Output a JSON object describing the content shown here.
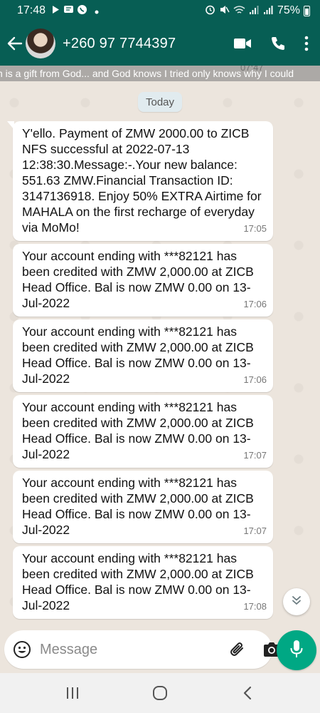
{
  "status_bar": {
    "time": "17:48",
    "battery": "75%",
    "left_icons": [
      "play-icon",
      "message-icon",
      "whatsapp-icon",
      "dot-icon"
    ],
    "right_icons": [
      "alarm-icon",
      "mute-icon",
      "wifi-icon",
      "signal-icon",
      "signal-icon",
      "battery-icon"
    ]
  },
  "header": {
    "contact": "+260 97 7744397",
    "icons": [
      "back-arrow-icon",
      "video-call-icon",
      "phone-icon",
      "more-vert-icon"
    ],
    "accent": "#075e54"
  },
  "status_strip": {
    "text": "n is a gift from God... and God knows I tried only knows why I could",
    "time": "07:47"
  },
  "date_chip": "Today",
  "messages": [
    {
      "text": "Y'ello. Payment of ZMW 2000.00 to ZICB NFS successful at 2022-07-13 12:38:30.Message:-.Your new balance: 551.63 ZMW.Financial Transaction ID: 3147136918. Enjoy 50% EXTRA Airtime for MAHALA on the first recharge of everyday via MoMo!",
      "time": "17:05"
    },
    {
      "text": "Your account ending with ***82121 has been credited with ZMW 2,000.00 at ZICB Head Office. Bal is now ZMW 0.00 on 13-Jul-2022",
      "time": "17:06"
    },
    {
      "text": "Your account ending with ***82121 has been credited with ZMW 2,000.00 at ZICB Head Office. Bal is now ZMW 0.00 on 13-Jul-2022",
      "time": "17:06"
    },
    {
      "text": "Your account ending with ***82121 has been credited with ZMW 2,000.00 at ZICB Head Office. Bal is now ZMW 0.00 on 13-Jul-2022",
      "time": "17:07"
    },
    {
      "text": "Your account ending with ***82121 has been credited with ZMW 2,000.00 at ZICB Head Office. Bal is now ZMW 0.00 on 13-Jul-2022",
      "time": "17:07"
    },
    {
      "text": "Your account ending with ***82121 has been credited with ZMW 2,000.00 at ZICB Head Office. Bal is now ZMW 0.00 on 13-Jul-2022",
      "time": "17:08"
    }
  ],
  "composer": {
    "placeholder": "Message",
    "icons": [
      "emoji-icon",
      "attach-icon",
      "camera-icon",
      "mic-icon"
    ],
    "mic_color": "#00a884"
  },
  "nav": {
    "icons": [
      "recent-apps-icon",
      "home-icon",
      "back-icon"
    ]
  }
}
